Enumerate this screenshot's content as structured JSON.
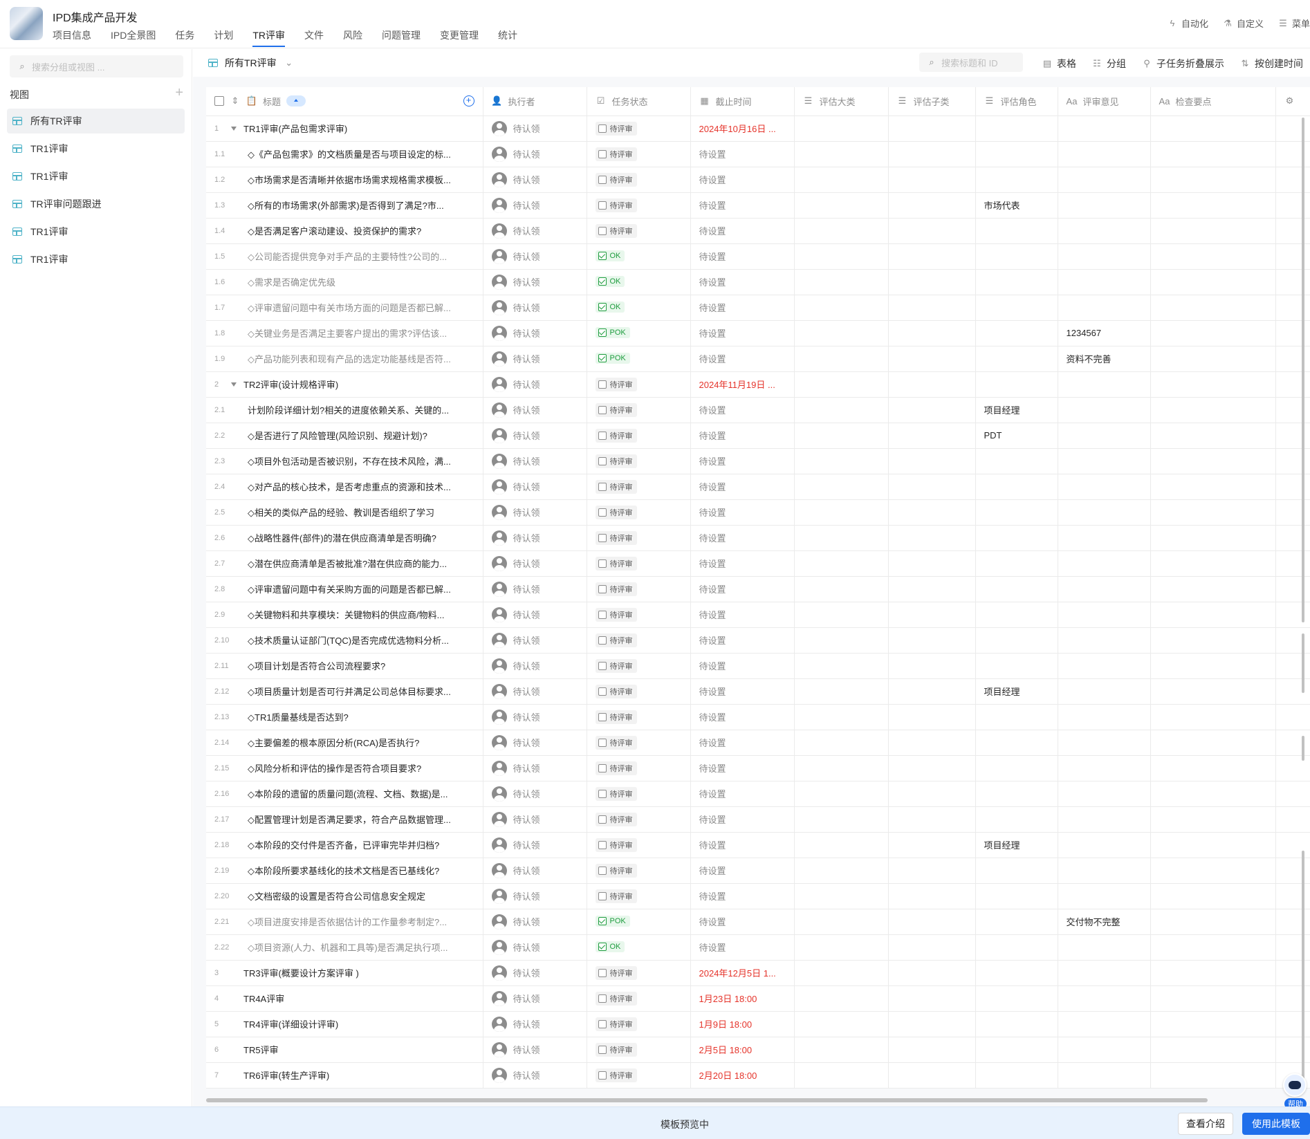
{
  "app": {
    "title": "IPD集成产品开发"
  },
  "nav": [
    "项目信息",
    "IPD全景图",
    "任务",
    "计划",
    "TR评审",
    "文件",
    "风险",
    "问题管理",
    "变更管理",
    "统计"
  ],
  "nav_active": "TR评审",
  "top_actions": [
    "自动化",
    "自定义",
    "菜单"
  ],
  "sidebar": {
    "search_placeholder": "搜索分组或视图 ...",
    "views_label": "视图",
    "items": [
      "所有TR评审",
      "TR1评审",
      "TR1评审",
      "TR评审问题跟进",
      "TR1评审",
      "TR1评审"
    ]
  },
  "toolbar": {
    "view_name": "所有TR评审",
    "search_placeholder": "搜索标题和 ID",
    "actions": [
      "表格",
      "分组",
      "子任务折叠展示",
      "按创建时间"
    ]
  },
  "columns": [
    "标题",
    "执行者",
    "任务状态",
    "截止时间",
    "评估大类",
    "评估子类",
    "评估角色",
    "评审意见",
    "检查要点"
  ],
  "rows": [
    {
      "id": "1",
      "level": 0,
      "title": "TR1评审(产品包需求评审)",
      "assignee": "待认领",
      "status": "待评审",
      "due": "2024年10月16日 ...",
      "role": "",
      "opinion": ""
    },
    {
      "id": "1.1",
      "level": 1,
      "title": "◇《产品包需求》的文档质量是否与项目设定的标...",
      "assignee": "待认领",
      "status": "待评审",
      "due": "待设置",
      "role": "",
      "opinion": ""
    },
    {
      "id": "1.2",
      "level": 1,
      "title": "◇市场需求是否清晰并依据市场需求规格需求模板...",
      "assignee": "待认领",
      "status": "待评审",
      "due": "待设置",
      "role": "",
      "opinion": ""
    },
    {
      "id": "1.3",
      "level": 1,
      "title": "◇所有的市场需求(外部需求)是否得到了满足?市...",
      "assignee": "待认领",
      "status": "待评审",
      "due": "待设置",
      "role": "市场代表",
      "opinion": ""
    },
    {
      "id": "1.4",
      "level": 1,
      "title": "◇是否满足客户滚动建设、投资保护的需求?",
      "assignee": "待认领",
      "status": "待评审",
      "due": "待设置",
      "role": "",
      "opinion": ""
    },
    {
      "id": "1.5",
      "level": 1,
      "title": "◇公司能否提供竞争对手产品的主要特性?公司的...",
      "assignee": "待认领",
      "status": "OK",
      "due": "待设置",
      "role": "",
      "opinion": ""
    },
    {
      "id": "1.6",
      "level": 1,
      "title": "◇需求是否确定优先级",
      "assignee": "待认领",
      "status": "OK",
      "due": "待设置",
      "role": "",
      "opinion": ""
    },
    {
      "id": "1.7",
      "level": 1,
      "title": "◇评审遗留问题中有关市场方面的问题是否都已解...",
      "assignee": "待认领",
      "status": "OK",
      "due": "待设置",
      "role": "",
      "opinion": ""
    },
    {
      "id": "1.8",
      "level": 1,
      "title": "◇关键业务是否满足主要客户提出的需求?评估该...",
      "assignee": "待认领",
      "status": "POK",
      "due": "待设置",
      "role": "",
      "opinion": "1234567"
    },
    {
      "id": "1.9",
      "level": 1,
      "title": "◇产品功能列表和现有产品的选定功能基线是否符...",
      "assignee": "待认领",
      "status": "POK",
      "due": "待设置",
      "role": "",
      "opinion": "资料不完善"
    },
    {
      "id": "2",
      "level": 0,
      "title": "TR2评审(设计规格评审)",
      "assignee": "待认领",
      "status": "待评审",
      "due": "2024年11月19日 ...",
      "role": "",
      "opinion": ""
    },
    {
      "id": "2.1",
      "level": 1,
      "title": "计划阶段详细计划?相关的进度依赖关系、关键的...",
      "assignee": "待认领",
      "status": "待评审",
      "due": "待设置",
      "role": "项目经理",
      "opinion": ""
    },
    {
      "id": "2.2",
      "level": 1,
      "title": "◇是否进行了风险管理(风险识别、规避计划)?",
      "assignee": "待认领",
      "status": "待评审",
      "due": "待设置",
      "role": "PDT",
      "opinion": ""
    },
    {
      "id": "2.3",
      "level": 1,
      "title": "◇项目外包活动是否被识别，不存在技术风险，满...",
      "assignee": "待认领",
      "status": "待评审",
      "due": "待设置",
      "role": "",
      "opinion": ""
    },
    {
      "id": "2.4",
      "level": 1,
      "title": "◇对产品的核心技术，是否考虑重点的资源和技术...",
      "assignee": "待认领",
      "status": "待评审",
      "due": "待设置",
      "role": "",
      "opinion": ""
    },
    {
      "id": "2.5",
      "level": 1,
      "title": "◇相关的类似产品的经验、教训是否组织了学习",
      "assignee": "待认领",
      "status": "待评审",
      "due": "待设置",
      "role": "",
      "opinion": ""
    },
    {
      "id": "2.6",
      "level": 1,
      "title": "◇战略性器件(部件)的潜在供应商清单是否明确?",
      "assignee": "待认领",
      "status": "待评审",
      "due": "待设置",
      "role": "",
      "opinion": ""
    },
    {
      "id": "2.7",
      "level": 1,
      "title": "◇潜在供应商清单是否被批准?潜在供应商的能力...",
      "assignee": "待认领",
      "status": "待评审",
      "due": "待设置",
      "role": "",
      "opinion": ""
    },
    {
      "id": "2.8",
      "level": 1,
      "title": "◇评审遗留问题中有关采购方面的问题是否都已解...",
      "assignee": "待认领",
      "status": "待评审",
      "due": "待设置",
      "role": "",
      "opinion": ""
    },
    {
      "id": "2.9",
      "level": 1,
      "title": "◇关键物料和共享模块：关键物料的供应商/物料...",
      "assignee": "待认领",
      "status": "待评审",
      "due": "待设置",
      "role": "",
      "opinion": ""
    },
    {
      "id": "2.10",
      "level": 1,
      "title": "◇技术质量认证部门(TQC)是否完成优选物料分析...",
      "assignee": "待认领",
      "status": "待评审",
      "due": "待设置",
      "role": "",
      "opinion": ""
    },
    {
      "id": "2.11",
      "level": 1,
      "title": "◇项目计划是否符合公司流程要求?",
      "assignee": "待认领",
      "status": "待评审",
      "due": "待设置",
      "role": "",
      "opinion": ""
    },
    {
      "id": "2.12",
      "level": 1,
      "title": "◇项目质量计划是否可行并满足公司总体目标要求...",
      "assignee": "待认领",
      "status": "待评审",
      "due": "待设置",
      "role": "项目经理",
      "opinion": ""
    },
    {
      "id": "2.13",
      "level": 1,
      "title": "◇TR1质量基线是否达到?",
      "assignee": "待认领",
      "status": "待评审",
      "due": "待设置",
      "role": "",
      "opinion": ""
    },
    {
      "id": "2.14",
      "level": 1,
      "title": "◇主要偏差的根本原因分析(RCA)是否执行?",
      "assignee": "待认领",
      "status": "待评审",
      "due": "待设置",
      "role": "",
      "opinion": ""
    },
    {
      "id": "2.15",
      "level": 1,
      "title": "◇风险分析和评估的操作是否符合项目要求?",
      "assignee": "待认领",
      "status": "待评审",
      "due": "待设置",
      "role": "",
      "opinion": ""
    },
    {
      "id": "2.16",
      "level": 1,
      "title": "◇本阶段的遗留的质量问题(流程、文档、数据)是...",
      "assignee": "待认领",
      "status": "待评审",
      "due": "待设置",
      "role": "",
      "opinion": ""
    },
    {
      "id": "2.17",
      "level": 1,
      "title": "◇配置管理计划是否满足要求，符合产品数据管理...",
      "assignee": "待认领",
      "status": "待评审",
      "due": "待设置",
      "role": "",
      "opinion": ""
    },
    {
      "id": "2.18",
      "level": 1,
      "title": "◇本阶段的交付件是否齐备，已评审完毕并归档?",
      "assignee": "待认领",
      "status": "待评审",
      "due": "待设置",
      "role": "项目经理",
      "opinion": ""
    },
    {
      "id": "2.19",
      "level": 1,
      "title": "◇本阶段所要求基线化的技术文档是否已基线化?",
      "assignee": "待认领",
      "status": "待评审",
      "due": "待设置",
      "role": "",
      "opinion": ""
    },
    {
      "id": "2.20",
      "level": 1,
      "title": "◇文档密级的设置是否符合公司信息安全规定",
      "assignee": "待认领",
      "status": "待评审",
      "due": "待设置",
      "role": "",
      "opinion": ""
    },
    {
      "id": "2.21",
      "level": 1,
      "title": "◇项目进度安排是否依据估计的工作量参考制定?...",
      "assignee": "待认领",
      "status": "POK",
      "due": "待设置",
      "role": "",
      "opinion": "交付物不完整"
    },
    {
      "id": "2.22",
      "level": 1,
      "title": "◇项目资源(人力、机器和工具等)是否满足执行项...",
      "assignee": "待认领",
      "status": "OK",
      "due": "待设置",
      "role": "",
      "opinion": ""
    },
    {
      "id": "3",
      "level": 0,
      "title": "TR3评审(概要设计方案评审 )",
      "assignee": "待认领",
      "status": "待评审",
      "due": "2024年12月5日 1...",
      "role": "",
      "opinion": ""
    },
    {
      "id": "4",
      "level": 0,
      "title": "TR4A评审",
      "assignee": "待认领",
      "status": "待评审",
      "due": "1月23日 18:00",
      "role": "",
      "opinion": ""
    },
    {
      "id": "5",
      "level": 0,
      "title": "TR4评审(详细设计评审)",
      "assignee": "待认领",
      "status": "待评审",
      "due": "1月9日 18:00",
      "role": "",
      "opinion": ""
    },
    {
      "id": "6",
      "level": 0,
      "title": "TR5评审",
      "assignee": "待认领",
      "status": "待评审",
      "due": "2月5日 18:00",
      "role": "",
      "opinion": ""
    },
    {
      "id": "7",
      "level": 0,
      "title": "TR6评审(转生产评审)",
      "assignee": "待认领",
      "status": "待评审",
      "due": "2月20日 18:00",
      "role": "",
      "opinion": ""
    }
  ],
  "bottom": {
    "message": "模板预览中",
    "intro_button": "查看介绍",
    "use_button": "使用此模板"
  },
  "help_label": "帮助",
  "colors": {
    "accent": "#1f6feb",
    "overdue": "#e5332a",
    "ok_green": "#1f9d3f"
  }
}
